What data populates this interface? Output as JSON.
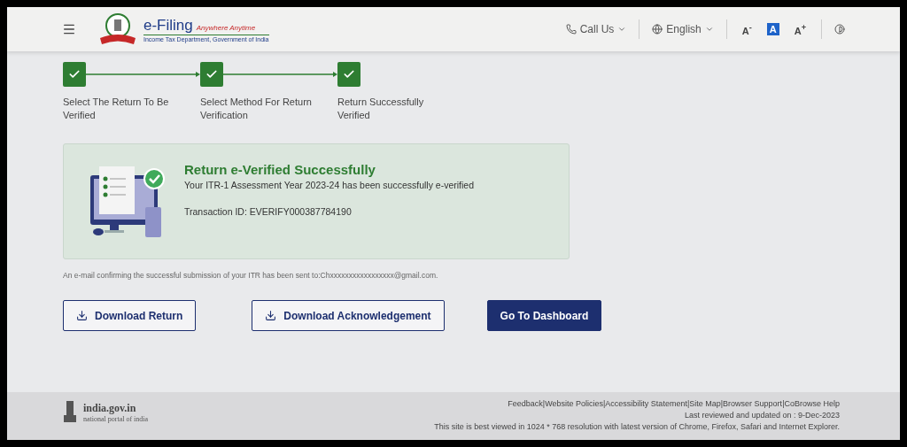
{
  "header": {
    "logo_title": "e-Filing",
    "logo_tagline": "Anywhere Anytime",
    "logo_subtitle": "Income Tax Department, Government of India",
    "actions": [
      {
        "kind": "phone",
        "label": "Call Us"
      },
      {
        "kind": "language",
        "label": "English"
      }
    ],
    "text_size_controls": [
      {
        "label": "A",
        "sign": "-",
        "selected": false
      },
      {
        "label": "A",
        "selected": true
      },
      {
        "label": "A",
        "sign": "+",
        "selected": false
      }
    ]
  },
  "steps": [
    {
      "label": "Select The Return To Be Verified",
      "completed": true
    },
    {
      "label": "Select Method For Return Verification",
      "completed": true
    },
    {
      "label": "Return Successfully Verified",
      "completed": true
    }
  ],
  "success_card": {
    "title": "Return e-Verified Successfully",
    "message": "Your ITR-1 Assessment Year 2023-24 has been successfully e-verified",
    "transaction": "Transaction ID: EVERIFY000387784190"
  },
  "email_note": "An e-mail confirming the successful submission of your ITR has been sent to:Chxxxxxxxxxxxxxxxxx@gmail.com.",
  "buttons": [
    {
      "kind": "download",
      "label": "Download Return"
    },
    {
      "kind": "download",
      "label": "Download Acknowledgement"
    },
    {
      "kind": "primary",
      "label": "Go To Dashboard"
    }
  ],
  "footer": {
    "portal_name": "india.gov.in",
    "portal_subtitle": "national portal of india",
    "links": [
      "Feedback",
      "|Website Policies",
      "|Accessibility Statement",
      "|Site Map",
      "|Browser Support",
      "|CoBrowse Help"
    ],
    "updated": "Last reviewed and updated on : 9-Dec-2023",
    "note": "This site is best viewed in 1024 * 768 resolution with latest version of Chrome, Firefox, Safari and Internet Explorer."
  }
}
